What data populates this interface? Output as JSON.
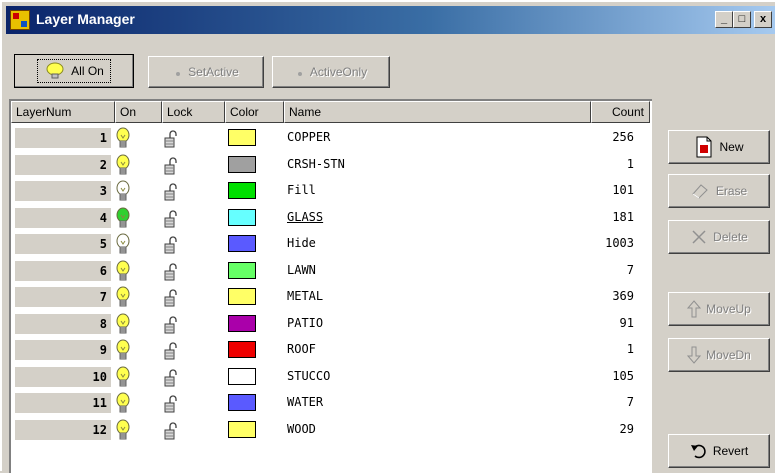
{
  "window": {
    "title": "Layer Manager",
    "controls": {
      "minimize": "_",
      "maximize": "□",
      "close": "x"
    }
  },
  "toolbar": {
    "all_on": "All On",
    "set_active": "SetActive",
    "active_only": "ActiveOnly"
  },
  "columns": {
    "num": "LayerNum",
    "on": "On",
    "lock": "Lock",
    "color": "Color",
    "name": "Name",
    "count": "Count"
  },
  "layers": [
    {
      "num": "1",
      "on": "on",
      "color": "#ffff66",
      "name": "COPPER",
      "count": "256"
    },
    {
      "num": "2",
      "on": "on",
      "color": "#a0a0a0",
      "name": "CRSH-STN",
      "count": "1"
    },
    {
      "num": "3",
      "on": "off",
      "color": "#00e000",
      "name": "Fill",
      "count": "101"
    },
    {
      "num": "4",
      "on": "active",
      "color": "#66ffff",
      "name": "GLASS",
      "count": "181"
    },
    {
      "num": "5",
      "on": "off",
      "color": "#5a5aff",
      "name": "Hide",
      "count": "1003"
    },
    {
      "num": "6",
      "on": "on",
      "color": "#66ff66",
      "name": "LAWN",
      "count": "7"
    },
    {
      "num": "7",
      "on": "on",
      "color": "#ffff66",
      "name": "METAL",
      "count": "369"
    },
    {
      "num": "8",
      "on": "on",
      "color": "#aa00aa",
      "name": "PATIO",
      "count": "91"
    },
    {
      "num": "9",
      "on": "on",
      "color": "#ee0000",
      "name": "ROOF",
      "count": "1"
    },
    {
      "num": "10",
      "on": "on",
      "color": "#ffffff",
      "name": "STUCCO",
      "count": "105"
    },
    {
      "num": "11",
      "on": "on",
      "color": "#5a5aff",
      "name": "WATER",
      "count": "7"
    },
    {
      "num": "12",
      "on": "on",
      "color": "#ffff66",
      "name": "WOOD",
      "count": "29"
    }
  ],
  "active_layer": "GLASS",
  "side_buttons": {
    "new": "New",
    "erase": "Erase",
    "delete": "Delete",
    "move_up": "MoveUp",
    "move_dn": "MoveDn",
    "revert": "Revert"
  },
  "icons": {
    "bulb_on": "lightbulb-on-icon",
    "bulb_off": "lightbulb-off-icon",
    "lock": "padlock-open-icon"
  },
  "colors": {
    "title_start": "#0a246a",
    "title_end": "#a6caf0",
    "bulb_on": "#ffff50",
    "bulb_active": "#30d030"
  }
}
